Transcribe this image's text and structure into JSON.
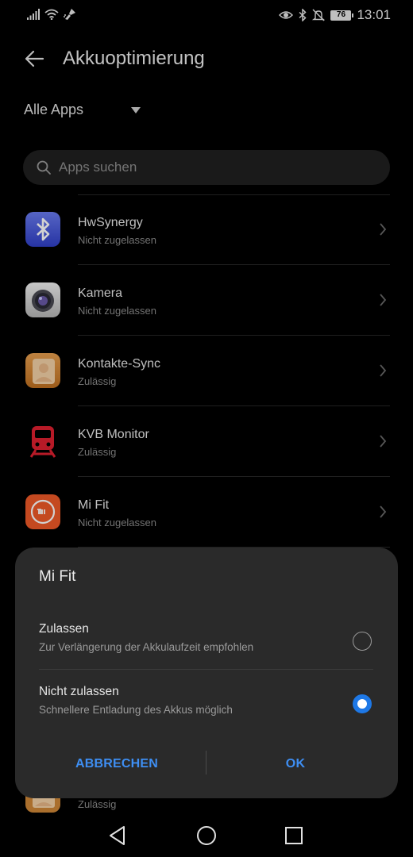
{
  "status_bar": {
    "time": "13:01",
    "battery": "76",
    "left_icons": [
      "signal-icon",
      "wifi-icon",
      "cleaner-icon"
    ],
    "right_icons": [
      "eye-icon",
      "bluetooth-icon",
      "mute-icon",
      "battery-icon"
    ]
  },
  "header": {
    "title": "Akkuoptimierung"
  },
  "filter": {
    "label": "Alle Apps"
  },
  "search": {
    "placeholder": "Apps suchen"
  },
  "apps": [
    {
      "name": "HwSynergy",
      "status": "Nicht zugelassen",
      "icon": "bluetooth-app-icon"
    },
    {
      "name": "Kamera",
      "status": "Nicht zugelassen",
      "icon": "camera-app-icon"
    },
    {
      "name": "Kontakte-Sync",
      "status": "Zulässig",
      "icon": "contacts-app-icon"
    },
    {
      "name": "KVB Monitor",
      "status": "Zulässig",
      "icon": "tram-app-icon"
    },
    {
      "name": "Mi Fit",
      "status": "Nicht zugelassen",
      "icon": "mi-app-icon"
    }
  ],
  "peek_row": {
    "status": "Zulässig"
  },
  "dialog": {
    "title": "Mi Fit",
    "options": [
      {
        "title": "Zulassen",
        "subtitle": "Zur Verlängerung der Akkulaufzeit empfohlen",
        "selected": false
      },
      {
        "title": "Nicht zulassen",
        "subtitle": "Schnellere Entladung des Akkus möglich",
        "selected": true
      }
    ],
    "cancel_label": "ABBRECHEN",
    "ok_label": "OK"
  },
  "colors": {
    "accent": "#3e8ef2",
    "radio_selected": "#1e78e6",
    "background": "#000000",
    "dialog_bg": "#2a2a2a"
  }
}
